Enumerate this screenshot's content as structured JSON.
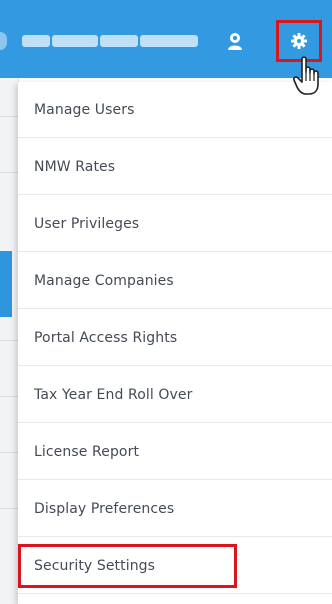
{
  "header": {
    "username_icon": "blurred-username",
    "user_icon": "user-avatar-icon",
    "settings_icon": "gear-icon",
    "cursor_icon": "hand-pointer-icon",
    "bar_color": "#3399e0",
    "highlight_color": "#d9151d"
  },
  "settings_menu": {
    "items": [
      {
        "label": "Manage Users"
      },
      {
        "label": "NMW Rates"
      },
      {
        "label": "User Privileges"
      },
      {
        "label": "Manage Companies"
      },
      {
        "label": "Portal Access Rights"
      },
      {
        "label": "Tax Year End Roll Over"
      },
      {
        "label": "License Report"
      },
      {
        "label": "Display Preferences"
      },
      {
        "label": "Security Settings",
        "highlighted": true
      }
    ]
  }
}
